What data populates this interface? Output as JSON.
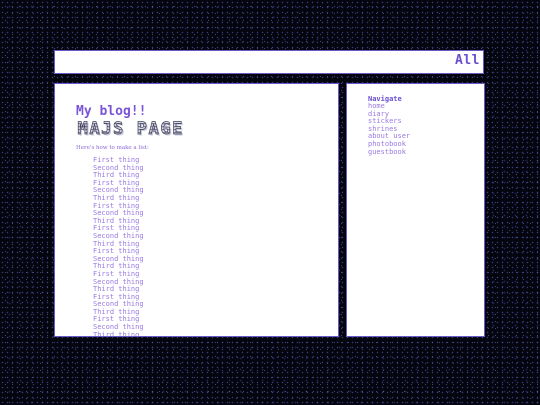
{
  "header": {
    "link_label": "All"
  },
  "main": {
    "title": "My blog!!",
    "logo_text": "MAJS PAGE",
    "intro": "Here's how to make a list:",
    "list_items": [
      "First thing",
      "Second thing",
      "Third thing",
      "First thing",
      "Second thing",
      "Third thing",
      "First thing",
      "Second thing",
      "Third thing",
      "First thing",
      "Second thing",
      "Third thing",
      "First thing",
      "Second thing",
      "Third thing",
      "First thing",
      "Second thing",
      "Third thing",
      "First thing",
      "Second thing",
      "Third thing",
      "First thing",
      "Second thing",
      "Third thing"
    ]
  },
  "sidebar": {
    "heading": "Navigate",
    "items": [
      "home",
      "diary",
      "stickers",
      "shrines",
      "about user",
      "photobook",
      "guestbook"
    ]
  },
  "colors": {
    "accent": "#6a4fd0",
    "link": "#9a7ae0",
    "border": "#6a58c8",
    "background": "#050510"
  }
}
